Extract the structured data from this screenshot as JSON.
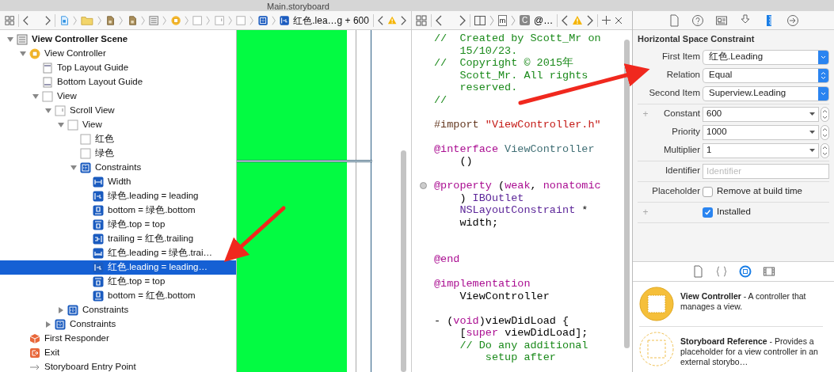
{
  "window": {
    "title": "Main.storyboard"
  },
  "editor_jump_bar": {
    "items": [
      {
        "kind": "storyboard-file"
      },
      {
        "kind": "folder"
      },
      {
        "kind": "doc"
      },
      {
        "kind": "doc"
      },
      {
        "kind": "scene"
      },
      {
        "kind": "controller"
      },
      {
        "kind": "view"
      },
      {
        "kind": "scroll-view"
      },
      {
        "kind": "view"
      },
      {
        "kind": "constraints"
      },
      {
        "kind": "c-leading",
        "label": "红色.lea…g + 600"
      }
    ]
  },
  "outline": {
    "items": [
      {
        "kind": "scene",
        "label": "View Controller Scene",
        "bold": true,
        "expanded": true,
        "selected": false,
        "children": [
          {
            "kind": "controller",
            "label": "View Controller",
            "expanded": true,
            "selected": false,
            "children": [
              {
                "kind": "guide-top",
                "label": "Top Layout Guide",
                "selected": false
              },
              {
                "kind": "guide-bottom",
                "label": "Bottom Layout Guide",
                "selected": false
              },
              {
                "kind": "view",
                "label": "View",
                "expanded": true,
                "selected": false,
                "children": [
                  {
                    "kind": "scroll-view",
                    "label": "Scroll View",
                    "expanded": true,
                    "selected": false,
                    "children": [
                      {
                        "kind": "view",
                        "label": "View",
                        "expanded": true,
                        "selected": false,
                        "children": [
                          {
                            "kind": "view",
                            "label": "红色",
                            "selected": false
                          },
                          {
                            "kind": "view",
                            "label": "绿色",
                            "selected": false
                          },
                          {
                            "kind": "constraints",
                            "label": "Constraints",
                            "expanded": true,
                            "selected": false,
                            "children": [
                              {
                                "kind": "c-width",
                                "label": "Width",
                                "selected": false
                              },
                              {
                                "kind": "c-leading",
                                "label": "绿色.leading = leading",
                                "selected": false
                              },
                              {
                                "kind": "c-bottom",
                                "label": "bottom = 绿色.bottom",
                                "selected": false
                              },
                              {
                                "kind": "c-top",
                                "label": "绿色.top = top",
                                "selected": false
                              },
                              {
                                "kind": "c-trailing",
                                "label": "trailing = 红色.trailing",
                                "selected": false
                              },
                              {
                                "kind": "c-space",
                                "label": "红色.leading = 绿色.trai…",
                                "selected": false
                              },
                              {
                                "kind": "c-leading",
                                "label": "红色.leading = leading…",
                                "selected": true
                              },
                              {
                                "kind": "c-top",
                                "label": "红色.top = top",
                                "selected": false
                              },
                              {
                                "kind": "c-bottom",
                                "label": "bottom = 红色.bottom",
                                "selected": false
                              }
                            ]
                          }
                        ]
                      },
                      {
                        "kind": "constraints",
                        "label": "Constraints",
                        "expanded": false,
                        "selected": false
                      }
                    ]
                  },
                  {
                    "kind": "constraints",
                    "label": "Constraints",
                    "expanded": false,
                    "selected": false
                  }
                ]
              }
            ]
          },
          {
            "kind": "first-responder",
            "label": "First Responder",
            "selected": false
          },
          {
            "kind": "exit",
            "label": "Exit",
            "selected": false
          },
          {
            "kind": "entry",
            "label": "Storyboard Entry Point",
            "selected": false
          }
        ]
      }
    ]
  },
  "code_jump_bar": {
    "file_letter": "m",
    "class_letter": "C",
    "symbol": "@…"
  },
  "code": {
    "lines": [
      {
        "kind": "code",
        "segments": [
          {
            "text": "//  Created by Scott_Mr on",
            "kind": "comment"
          }
        ]
      },
      {
        "kind": "code",
        "segments": [
          {
            "text": "    15/10/23.",
            "kind": "comment"
          }
        ]
      },
      {
        "kind": "code",
        "segments": [
          {
            "text": "//  Copyright © 2015年",
            "kind": "comment"
          }
        ]
      },
      {
        "kind": "code",
        "segments": [
          {
            "text": "    Scott_Mr. All rights",
            "kind": "comment"
          }
        ]
      },
      {
        "kind": "code",
        "segments": [
          {
            "text": "    reserved.",
            "kind": "comment"
          }
        ]
      },
      {
        "kind": "code",
        "segments": [
          {
            "text": "//",
            "kind": "comment"
          }
        ]
      },
      {
        "kind": "blank"
      },
      {
        "kind": "code",
        "segments": [
          {
            "text": "#import ",
            "kind": "preprocessor"
          },
          {
            "text": "\"ViewController.h\"",
            "kind": "string"
          }
        ]
      },
      {
        "kind": "blank"
      },
      {
        "kind": "code",
        "segments": [
          {
            "text": "@interface",
            "kind": "keyword"
          },
          {
            "text": " ViewController",
            "kind": "class"
          }
        ]
      },
      {
        "kind": "code",
        "segments": [
          {
            "text": "    ()",
            "kind": "plain"
          }
        ]
      },
      {
        "kind": "blank"
      },
      {
        "kind": "code",
        "breakpoint": true,
        "segments": [
          {
            "text": "@property",
            "kind": "keyword"
          },
          {
            "text": " (",
            "kind": "plain"
          },
          {
            "text": "weak",
            "kind": "keyword"
          },
          {
            "text": ", ",
            "kind": "plain"
          },
          {
            "text": "nonatomic",
            "kind": "keyword"
          }
        ]
      },
      {
        "kind": "code",
        "segments": [
          {
            "text": "    ) ",
            "kind": "plain"
          },
          {
            "text": "IBOutlet",
            "kind": "type"
          }
        ]
      },
      {
        "kind": "code",
        "segments": [
          {
            "text": "    NSLayoutConstraint",
            "kind": "type"
          },
          {
            "text": " *",
            "kind": "plain"
          }
        ]
      },
      {
        "kind": "code",
        "segments": [
          {
            "text": "    width;",
            "kind": "plain"
          }
        ]
      },
      {
        "kind": "blank"
      },
      {
        "kind": "blank"
      },
      {
        "kind": "code",
        "segments": [
          {
            "text": "@end",
            "kind": "keyword"
          }
        ]
      },
      {
        "kind": "blank"
      },
      {
        "kind": "code",
        "segments": [
          {
            "text": "@implementation",
            "kind": "keyword"
          }
        ]
      },
      {
        "kind": "code",
        "segments": [
          {
            "text": "    ViewController",
            "kind": "plain"
          }
        ]
      },
      {
        "kind": "blank"
      },
      {
        "kind": "code",
        "segments": [
          {
            "text": "- (",
            "kind": "plain"
          },
          {
            "text": "void",
            "kind": "keyword"
          },
          {
            "text": ")viewDidLoad {",
            "kind": "plain"
          }
        ]
      },
      {
        "kind": "code",
        "segments": [
          {
            "text": "    [",
            "kind": "plain"
          },
          {
            "text": "super",
            "kind": "keyword"
          },
          {
            "text": " viewDidLoad];",
            "kind": "plain"
          }
        ]
      },
      {
        "kind": "code",
        "segments": [
          {
            "text": "    // Do any additional",
            "kind": "comment"
          }
        ]
      },
      {
        "kind": "code",
        "segments": [
          {
            "text": "        setup after",
            "kind": "comment"
          }
        ]
      }
    ]
  },
  "inspector": {
    "tabs": [
      {
        "kind": "file",
        "selected": false
      },
      {
        "kind": "help",
        "selected": false
      },
      {
        "kind": "identity",
        "selected": false
      },
      {
        "kind": "attributes",
        "selected": false
      },
      {
        "kind": "size",
        "selected": true
      },
      {
        "kind": "connections",
        "selected": false
      }
    ],
    "title": "Horizontal Space Constraint",
    "groups": [
      [
        {
          "kind": "popup",
          "label": "First Item",
          "value": "红色.Leading"
        },
        {
          "kind": "popup-updown",
          "label": "Relation",
          "value": "Equal"
        },
        {
          "kind": "popup",
          "label": "Second Item",
          "value": "Superview.Leading"
        }
      ],
      [
        {
          "kind": "combo",
          "label": "Constant",
          "value": "600",
          "add": "+"
        },
        {
          "kind": "combo",
          "label": "Priority",
          "value": "1000"
        },
        {
          "kind": "combo",
          "label": "Multiplier",
          "value": "1"
        }
      ],
      [
        {
          "kind": "text",
          "label": "Identifier",
          "placeholder": "Identifier"
        }
      ],
      [
        {
          "kind": "checkbox",
          "label": "Placeholder",
          "text": "Remove at build time",
          "checked": false
        }
      ],
      [
        {
          "kind": "checkbox",
          "text": "Installed",
          "checked": true,
          "add": "+"
        }
      ]
    ]
  },
  "library": {
    "tabs": [
      {
        "kind": "file",
        "selected": false
      },
      {
        "kind": "braces",
        "selected": false
      },
      {
        "kind": "object",
        "selected": true
      },
      {
        "kind": "media",
        "selected": false
      }
    ],
    "items": [
      {
        "kind": "controller",
        "text": "**View Controller** - A controller that manages a view."
      },
      {
        "kind": "reference",
        "text": "**Storyboard Reference** - Provides a placeholder for a view controller in an external storybo…"
      }
    ]
  }
}
